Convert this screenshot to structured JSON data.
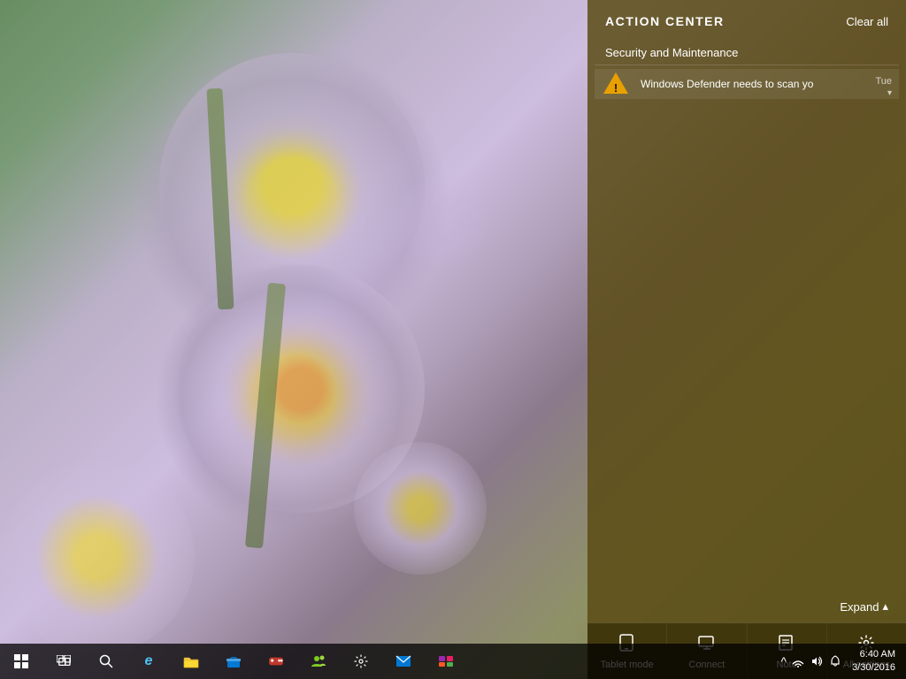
{
  "desktop": {
    "background_description": "Purple aster flowers on green background"
  },
  "action_center": {
    "title": "ACTION CENTER",
    "clear_all_label": "Clear all",
    "expand_label": "Expand",
    "sections": [
      {
        "id": "security-maintenance",
        "label": "Security and Maintenance",
        "notifications": [
          {
            "id": "defender-scan",
            "icon": "warning",
            "text": "Windows Defender needs to scan yo",
            "time": "Tue",
            "has_chevron": true
          }
        ]
      }
    ],
    "quick_actions": [
      {
        "id": "tablet-mode",
        "label": "Tablet mode",
        "icon": "⊞"
      },
      {
        "id": "connect",
        "label": "Connect",
        "icon": "⊡"
      },
      {
        "id": "note",
        "label": "Note",
        "icon": "☐"
      },
      {
        "id": "all-settings",
        "label": "All settings",
        "icon": "⚙"
      }
    ]
  },
  "taskbar": {
    "items": [
      {
        "id": "start",
        "icon": "⊞",
        "label": "Start"
      },
      {
        "id": "task-view",
        "icon": "❒",
        "label": "Task View"
      },
      {
        "id": "search",
        "icon": "🔍",
        "label": "Search"
      },
      {
        "id": "edge",
        "icon": "ℯ",
        "label": "Microsoft Edge"
      },
      {
        "id": "file-explorer",
        "icon": "📁",
        "label": "File Explorer"
      },
      {
        "id": "store",
        "icon": "🛍",
        "label": "Store"
      },
      {
        "id": "game",
        "icon": "🎮",
        "label": "Game"
      },
      {
        "id": "people",
        "icon": "👥",
        "label": "People"
      },
      {
        "id": "settings",
        "icon": "⚙",
        "label": "Settings"
      },
      {
        "id": "mail",
        "icon": "✉",
        "label": "Mail"
      },
      {
        "id": "app2",
        "icon": "🖼",
        "label": "App"
      }
    ],
    "systray": {
      "chevron": "^",
      "network": "🌐",
      "speaker": "🔊",
      "notification": "💬"
    },
    "clock": {
      "time": "6:40 AM",
      "date": "3/30/2016"
    }
  }
}
